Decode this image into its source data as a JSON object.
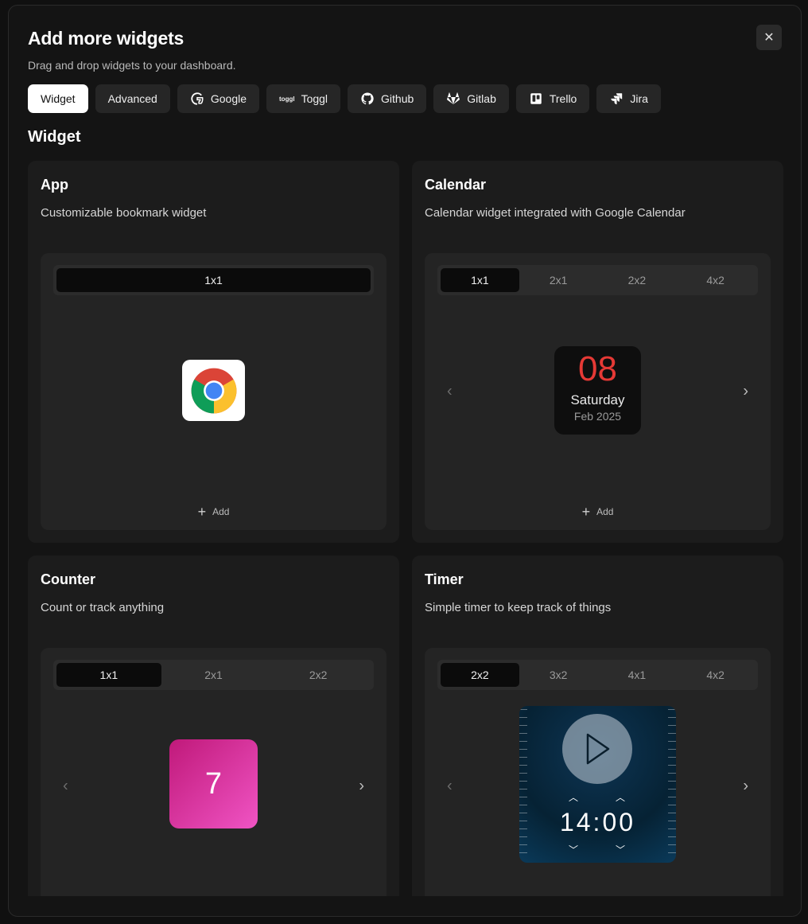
{
  "modal": {
    "title": "Add more widgets",
    "subtitle": "Drag and drop widgets to your dashboard.",
    "close_icon": "close-icon"
  },
  "tabs": [
    {
      "label": "Widget",
      "active": true,
      "icon": ""
    },
    {
      "label": "Advanced",
      "active": false,
      "icon": ""
    },
    {
      "label": "Google",
      "active": false,
      "icon": "google-icon"
    },
    {
      "label": "Toggl",
      "active": false,
      "icon": "toggl-icon"
    },
    {
      "label": "Github",
      "active": false,
      "icon": "github-icon"
    },
    {
      "label": "Gitlab",
      "active": false,
      "icon": "gitlab-icon"
    },
    {
      "label": "Trello",
      "active": false,
      "icon": "trello-icon"
    },
    {
      "label": "Jira",
      "active": false,
      "icon": "jira-icon"
    }
  ],
  "section_title": "Widget",
  "cards": {
    "app": {
      "title": "App",
      "description": "Customizable bookmark widget",
      "sizes": [
        "1x1"
      ],
      "active_size": "1x1",
      "add_label": "Add"
    },
    "calendar": {
      "title": "Calendar",
      "description": "Calendar widget integrated with Google Calendar",
      "sizes": [
        "1x1",
        "2x1",
        "2x2",
        "4x2"
      ],
      "active_size": "1x1",
      "day": "08",
      "weekday": "Saturday",
      "month": "Feb 2025",
      "add_label": "Add"
    },
    "counter": {
      "title": "Counter",
      "description": "Count or track anything",
      "sizes": [
        "1x1",
        "2x1",
        "2x2"
      ],
      "active_size": "1x1",
      "value": "7"
    },
    "timer": {
      "title": "Timer",
      "description": "Simple timer to keep track of things",
      "sizes": [
        "2x2",
        "3x2",
        "4x1",
        "4x2"
      ],
      "active_size": "2x2",
      "time_minutes": "14",
      "time_seconds": "00"
    }
  },
  "colors": {
    "calendar_day": "#e53935",
    "counter_gradient_start": "#c0197a",
    "counter_gradient_end": "#f054c4"
  }
}
